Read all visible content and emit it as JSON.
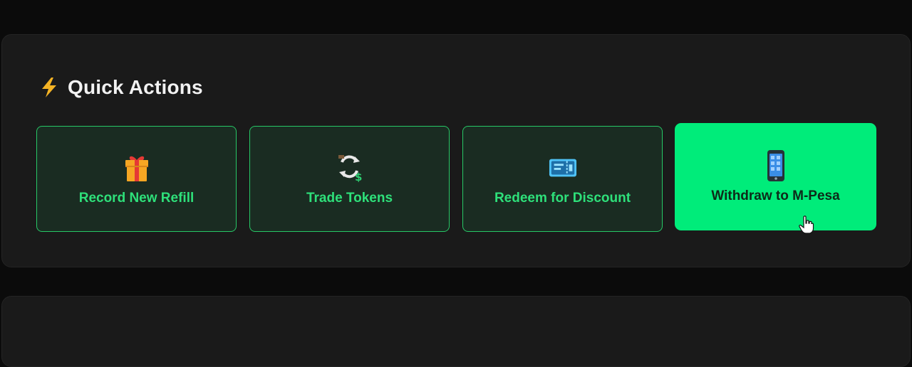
{
  "quick_actions": {
    "title": "Quick Actions",
    "title_icon": "lightning-bolt-icon",
    "accent_color": "#2ee07a",
    "active_color": "#00ec7a",
    "items": [
      {
        "label": "Record New Refill",
        "icon": "gift-icon"
      },
      {
        "label": "Trade Tokens",
        "icon": "exchange-icon"
      },
      {
        "label": "Redeem for Discount",
        "icon": "ticket-icon"
      },
      {
        "label": "Withdraw to M-Pesa",
        "icon": "mobile-phone-icon",
        "state": "hovered"
      }
    ]
  }
}
